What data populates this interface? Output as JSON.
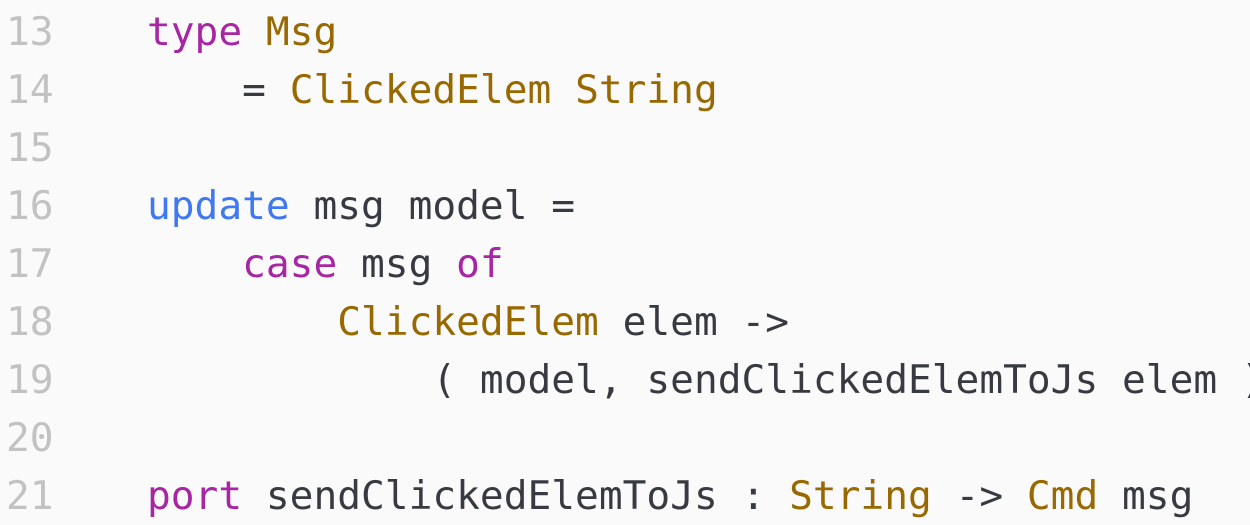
{
  "editor": {
    "lines": [
      {
        "number": "13",
        "tokens": [
          {
            "text": "type",
            "kind": "kw-purple"
          },
          {
            "text": " ",
            "kind": "plain"
          },
          {
            "text": "Msg",
            "kind": "type"
          }
        ]
      },
      {
        "number": "14",
        "tokens": [
          {
            "text": "    = ",
            "kind": "plain"
          },
          {
            "text": "ClickedElem",
            "kind": "type"
          },
          {
            "text": " ",
            "kind": "plain"
          },
          {
            "text": "String",
            "kind": "type"
          }
        ]
      },
      {
        "number": "15",
        "tokens": []
      },
      {
        "number": "16",
        "tokens": [
          {
            "text": "update",
            "kind": "kw-blue"
          },
          {
            "text": " msg model =",
            "kind": "plain"
          }
        ]
      },
      {
        "number": "17",
        "tokens": [
          {
            "text": "    ",
            "kind": "plain"
          },
          {
            "text": "case",
            "kind": "kw-purple"
          },
          {
            "text": " msg ",
            "kind": "plain"
          },
          {
            "text": "of",
            "kind": "kw-purple"
          }
        ]
      },
      {
        "number": "18",
        "tokens": [
          {
            "text": "        ",
            "kind": "plain"
          },
          {
            "text": "ClickedElem",
            "kind": "type"
          },
          {
            "text": " elem ->",
            "kind": "plain"
          }
        ]
      },
      {
        "number": "19",
        "tokens": [
          {
            "text": "            ( model, sendClickedElemToJs elem )",
            "kind": "plain"
          }
        ]
      },
      {
        "number": "20",
        "tokens": []
      },
      {
        "number": "21",
        "tokens": [
          {
            "text": "port",
            "kind": "kw-purple"
          },
          {
            "text": " sendClickedElemToJs : ",
            "kind": "plain"
          },
          {
            "text": "String",
            "kind": "type"
          },
          {
            "text": " -> ",
            "kind": "plain"
          },
          {
            "text": "Cmd",
            "kind": "type"
          },
          {
            "text": " msg",
            "kind": "plain"
          }
        ]
      }
    ],
    "colors": {
      "background": "#fafafa",
      "line_number": "#c2c2c2",
      "keyword_purple": "#a626a4",
      "keyword_blue": "#4078f2",
      "type": "#986801",
      "text": "#383a42"
    }
  }
}
